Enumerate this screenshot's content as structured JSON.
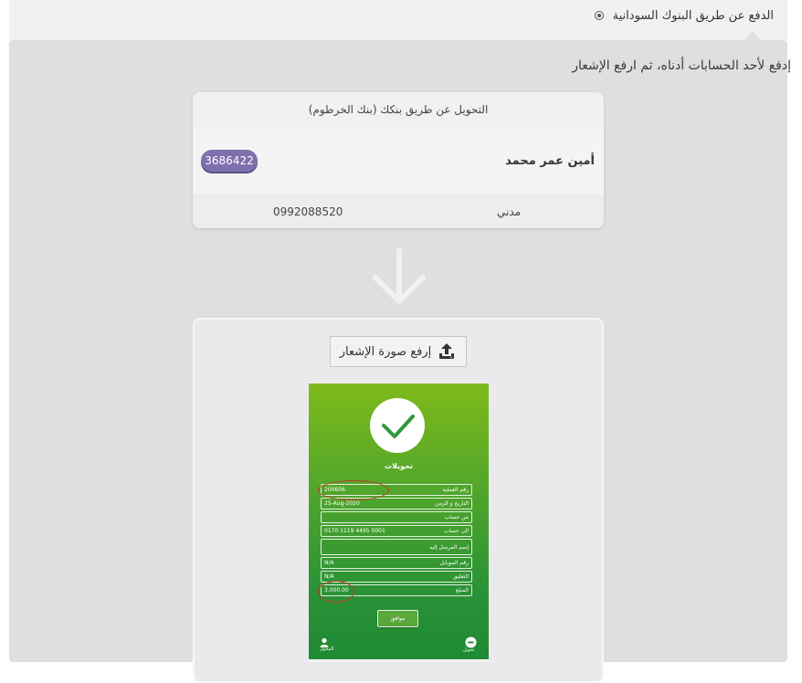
{
  "payment_option": {
    "label": "الدفع عن طريق البنوك السودانية",
    "selected": true
  },
  "instruction": "إدفع لأحد الحسابات أدناه، ثم ارفع الإشعار",
  "bank_card": {
    "title": "التحويل عن طريق بنكك (بنك الخرطوم)",
    "account_name": "أمين عمر محمد",
    "account_number": "3686422",
    "branch": "مدني",
    "phone": "0992088520"
  },
  "upload": {
    "button_label": "إرفع صورة الإشعار",
    "icon": "upload-icon"
  },
  "receipt": {
    "heading": "تحويلات",
    "rows": [
      {
        "label": "رقم العملية",
        "value": "200606"
      },
      {
        "label": "التاريخ و الزمن",
        "value": "25-Aug-2020"
      },
      {
        "label": "من حساب",
        "value": ""
      },
      {
        "label": "الى حساب",
        "value": "0170 1119 4495 0001"
      },
      {
        "label": "إسم المرسل إليه",
        "value": ""
      },
      {
        "label": "رقم الموبايل",
        "value": "N/A"
      },
      {
        "label": "التعليق",
        "value": "N/A"
      },
      {
        "label": "المبلغ",
        "value": "3,000.00"
      }
    ],
    "ok_label": "موافق",
    "left_icon_label": "المحول",
    "right_icon_label": "تحويل"
  },
  "colors": {
    "badge": "#7e70ad",
    "panel": "#e0dfdf",
    "highlight_oval": "#c0392b"
  }
}
